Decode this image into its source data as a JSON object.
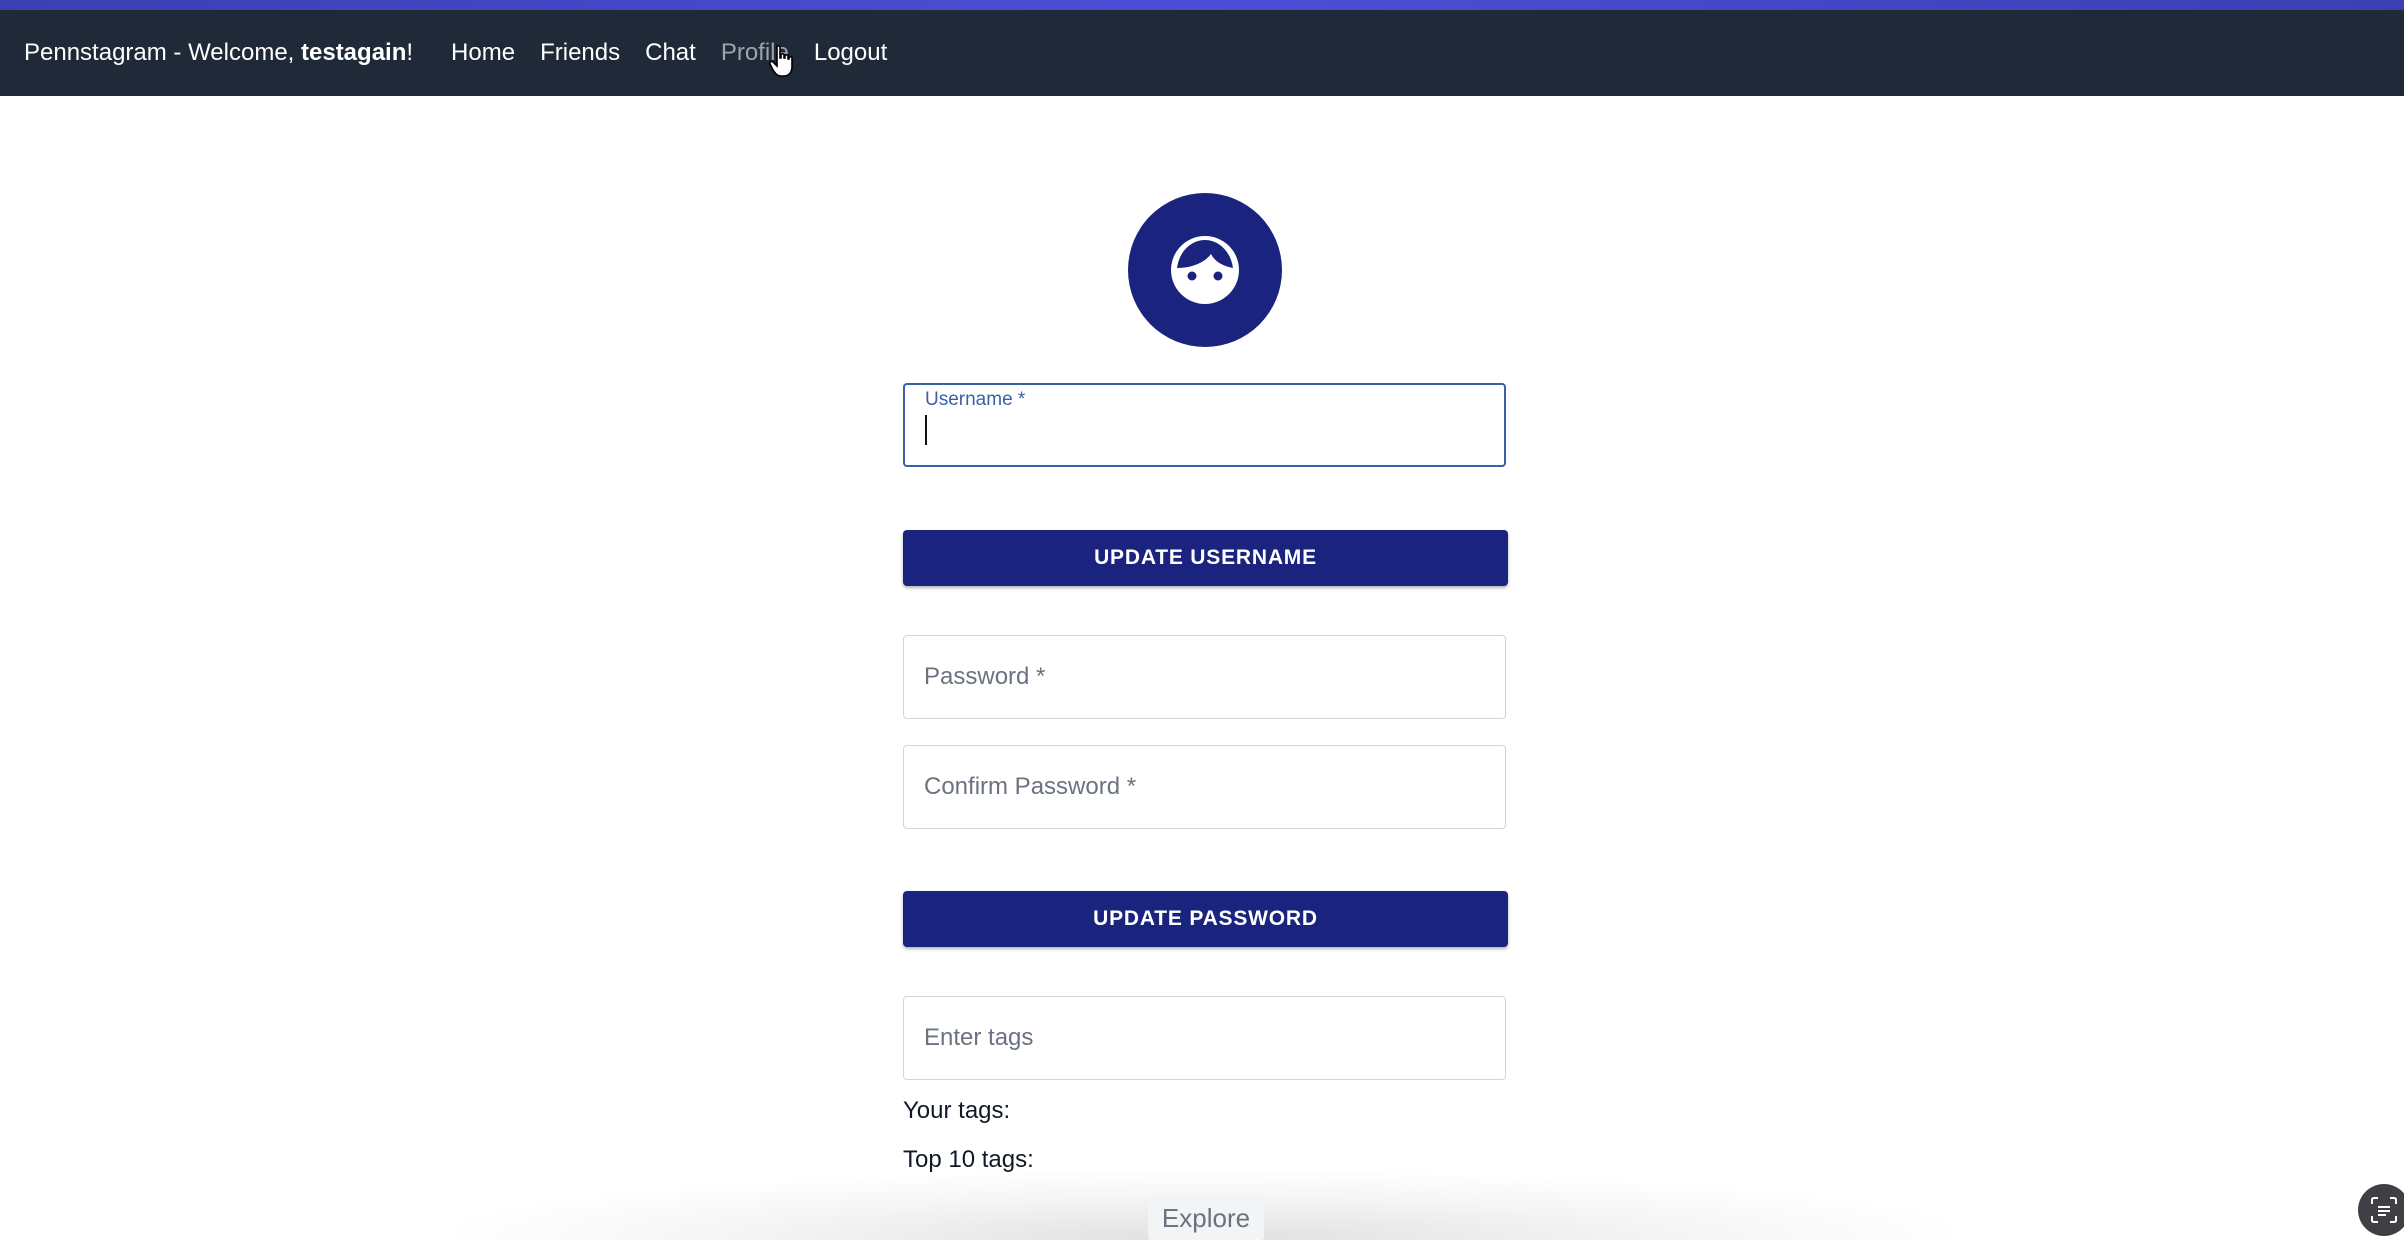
{
  "navbar": {
    "brand_prefix": "Pennstagram - Welcome, ",
    "username": "testagain",
    "brand_suffix": "!",
    "links": [
      {
        "label": "Home"
      },
      {
        "label": "Friends"
      },
      {
        "label": "Chat"
      },
      {
        "label": "Profile"
      },
      {
        "label": "Logout"
      }
    ]
  },
  "profile": {
    "avatar_icon": "face-icon",
    "username_field": {
      "label": "Username *",
      "value": ""
    },
    "update_username_label": "UPDATE USERNAME",
    "password_field": {
      "placeholder": "Password *"
    },
    "confirm_password_field": {
      "placeholder": "Confirm Password *"
    },
    "update_password_label": "UPDATE PASSWORD",
    "tags_field": {
      "placeholder": "Enter tags"
    },
    "your_tags_label": "Your tags:",
    "top_tags_label": "Top 10 tags:"
  },
  "footer": {
    "explore_label": "Explore"
  },
  "colors": {
    "navbar_bg": "#1f2937",
    "accent": "#1a237e",
    "focus_border": "#3b5fa8"
  }
}
